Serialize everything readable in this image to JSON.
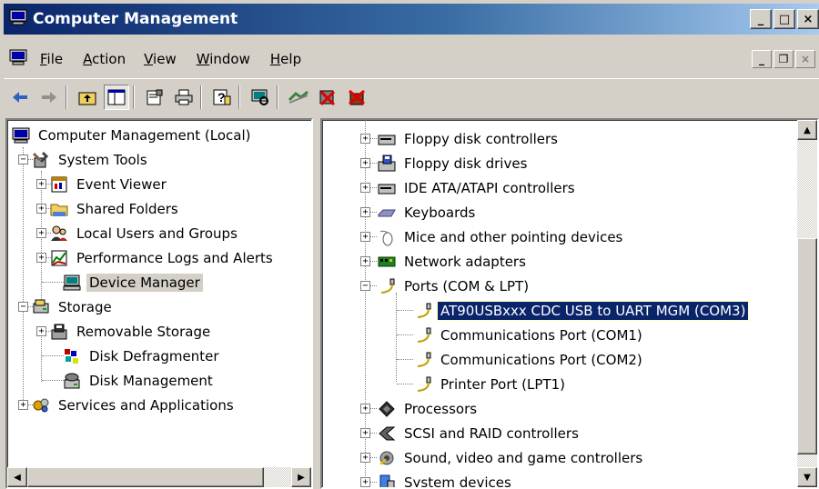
{
  "window": {
    "title": "Computer Management",
    "caption_minimize": "_",
    "caption_maximize": "□",
    "caption_close": "×"
  },
  "menu": {
    "items": [
      {
        "label": "File",
        "accel": "F",
        "rest": "ile"
      },
      {
        "label": "Action",
        "accel": "A",
        "rest": "ction"
      },
      {
        "label": "View",
        "accel": "V",
        "rest": "iew"
      },
      {
        "label": "Window",
        "accel": "W",
        "rest": "indow"
      },
      {
        "label": "Help",
        "accel": "H",
        "rest": "elp"
      }
    ],
    "mdi_minimize": "_",
    "mdi_restore": "❐",
    "mdi_close": "×"
  },
  "toolbar": {
    "icons": [
      "back-arrow-icon",
      "forward-arrow-icon",
      "up-one-level-icon",
      "show-hide-tree-icon",
      "properties-icon",
      "print-icon",
      "help-icon",
      "scan-hardware-icon",
      "update-driver-icon",
      "disable-device-icon",
      "uninstall-device-icon"
    ]
  },
  "left_tree": {
    "root": "Computer Management (Local)",
    "system_tools": "System Tools",
    "event_viewer": "Event Viewer",
    "shared_folders": "Shared Folders",
    "local_users": "Local Users and Groups",
    "perf_logs": "Performance Logs and Alerts",
    "device_manager": "Device Manager",
    "storage": "Storage",
    "removable_storage": "Removable Storage",
    "disk_defrag": "Disk Defragmenter",
    "disk_mgmt": "Disk Management",
    "services_apps": "Services and Applications"
  },
  "right_tree": {
    "floppy_ctrl": "Floppy disk controllers",
    "floppy_drives": "Floppy disk drives",
    "ide": "IDE ATA/ATAPI controllers",
    "keyboards": "Keyboards",
    "mice": "Mice and other pointing devices",
    "network": "Network adapters",
    "ports": "Ports (COM & LPT)",
    "port_at90": "AT90USBxxx CDC USB to UART MGM (COM3)",
    "port_com1": "Communications Port (COM1)",
    "port_com2": "Communications Port (COM2)",
    "port_lpt1": "Printer Port (LPT1)",
    "processors": "Processors",
    "scsi": "SCSI and RAID controllers",
    "sound": "Sound, video and game controllers",
    "system_devices": "System devices"
  },
  "expanders": {
    "plus": "+",
    "minus": "−"
  },
  "scroll": {
    "left": "◀",
    "right": "▶",
    "up": "▲",
    "down": "▼"
  }
}
